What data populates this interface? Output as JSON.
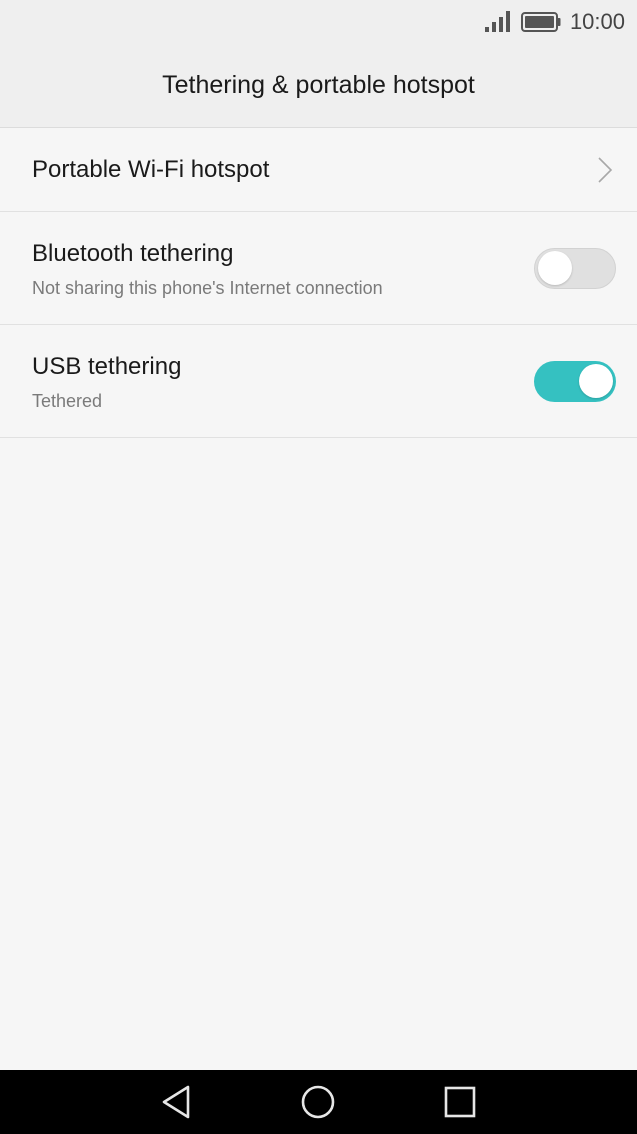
{
  "status_bar": {
    "time": "10:00",
    "icons": [
      "signal-icon",
      "battery-icon"
    ]
  },
  "header": {
    "title": "Tethering & portable hotspot"
  },
  "settings": [
    {
      "title": "Portable Wi-Fi hotspot",
      "control": "chevron"
    },
    {
      "title": "Bluetooth tethering",
      "subtitle": "Not sharing this phone's Internet connection",
      "control": "toggle",
      "enabled": false
    },
    {
      "title": "USB tethering",
      "subtitle": "Tethered",
      "control": "toggle",
      "enabled": true
    }
  ],
  "nav_bar": {
    "icons": [
      "back-icon",
      "home-icon",
      "recent-apps-icon"
    ]
  },
  "colors": {
    "accent": "#35c1c1",
    "background": "#f6f6f6",
    "header_background": "#efefef",
    "nav_background": "#000000"
  }
}
